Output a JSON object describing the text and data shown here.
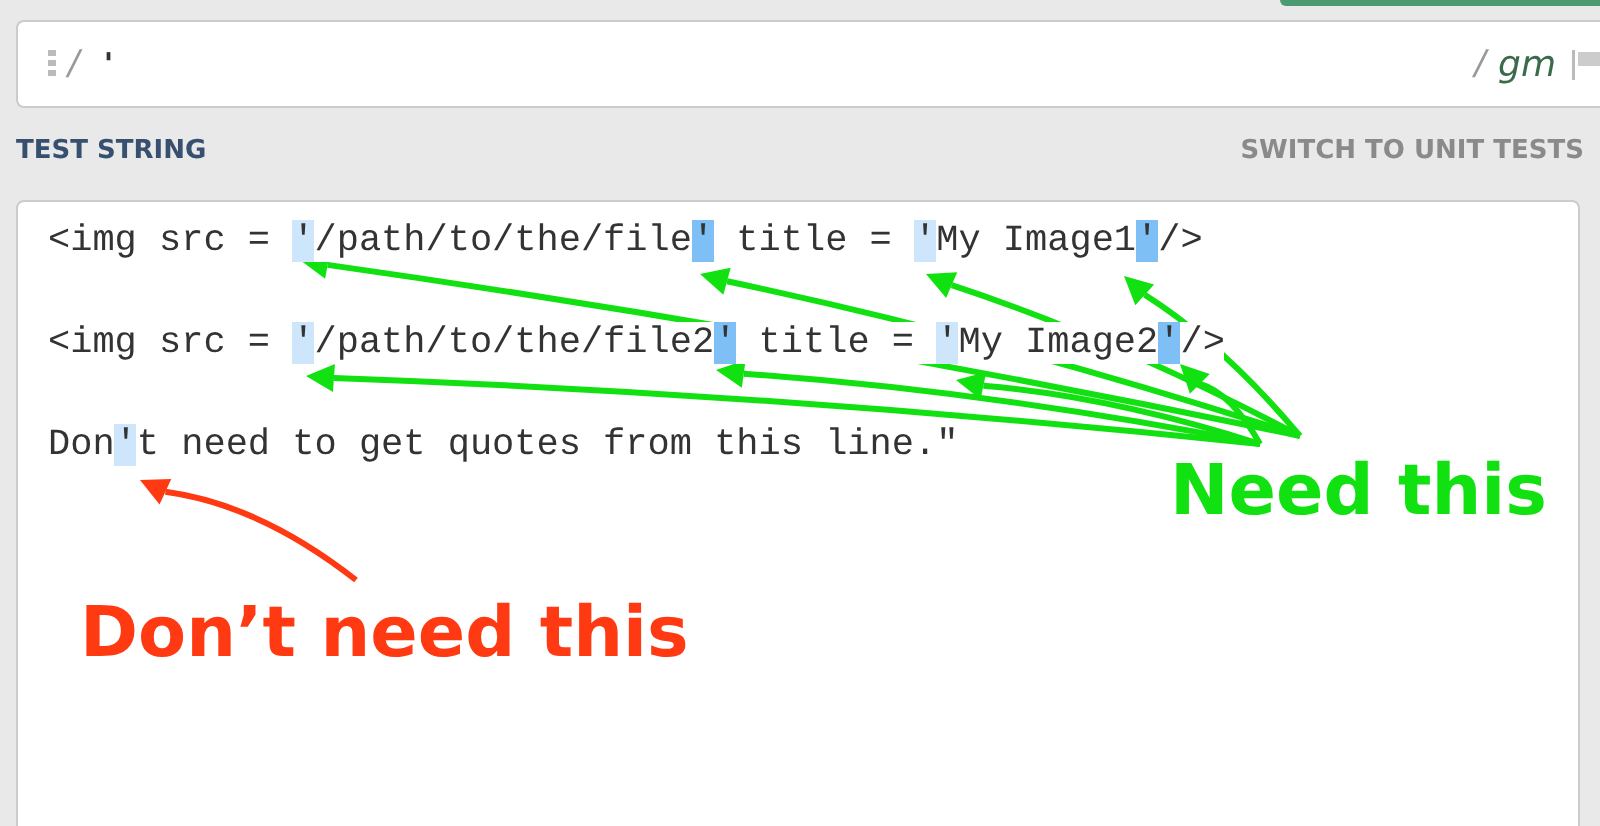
{
  "regex": {
    "delimiter_open": "/",
    "pattern": "'",
    "delimiter_close": "/",
    "flags": "gm"
  },
  "test_string_header": {
    "title": "TEST STRING",
    "switch_link": "SWITCH TO UNIT TESTS"
  },
  "test_lines": [
    [
      {
        "text": "<img src = ",
        "kind": "text"
      },
      {
        "text": "'",
        "kind": "match"
      },
      {
        "text": "/path/to/the/file",
        "kind": "text"
      },
      {
        "text": "'",
        "kind": "match-alt"
      },
      {
        "text": " title = ",
        "kind": "text"
      },
      {
        "text": "'",
        "kind": "match"
      },
      {
        "text": "My Image1",
        "kind": "text"
      },
      {
        "text": "'",
        "kind": "match-alt"
      },
      {
        "text": "/>",
        "kind": "text"
      }
    ],
    [
      {
        "text": "<img src = ",
        "kind": "text"
      },
      {
        "text": "'",
        "kind": "match"
      },
      {
        "text": "/path/to/the/file2",
        "kind": "text"
      },
      {
        "text": "'",
        "kind": "match-alt"
      },
      {
        "text": " title = ",
        "kind": "text"
      },
      {
        "text": "'",
        "kind": "match"
      },
      {
        "text": "My Image2",
        "kind": "text"
      },
      {
        "text": "'",
        "kind": "match-alt"
      },
      {
        "text": "/>",
        "kind": "text"
      }
    ],
    [
      {
        "text": "Don",
        "kind": "text"
      },
      {
        "text": "'",
        "kind": "match"
      },
      {
        "text": "t need to get quotes from this line.\"",
        "kind": "text"
      }
    ]
  ],
  "annotations": [
    {
      "label": "Need this",
      "color": "#11e011"
    },
    {
      "label": "Don’t need this",
      "color": "#ff3a12"
    }
  ]
}
